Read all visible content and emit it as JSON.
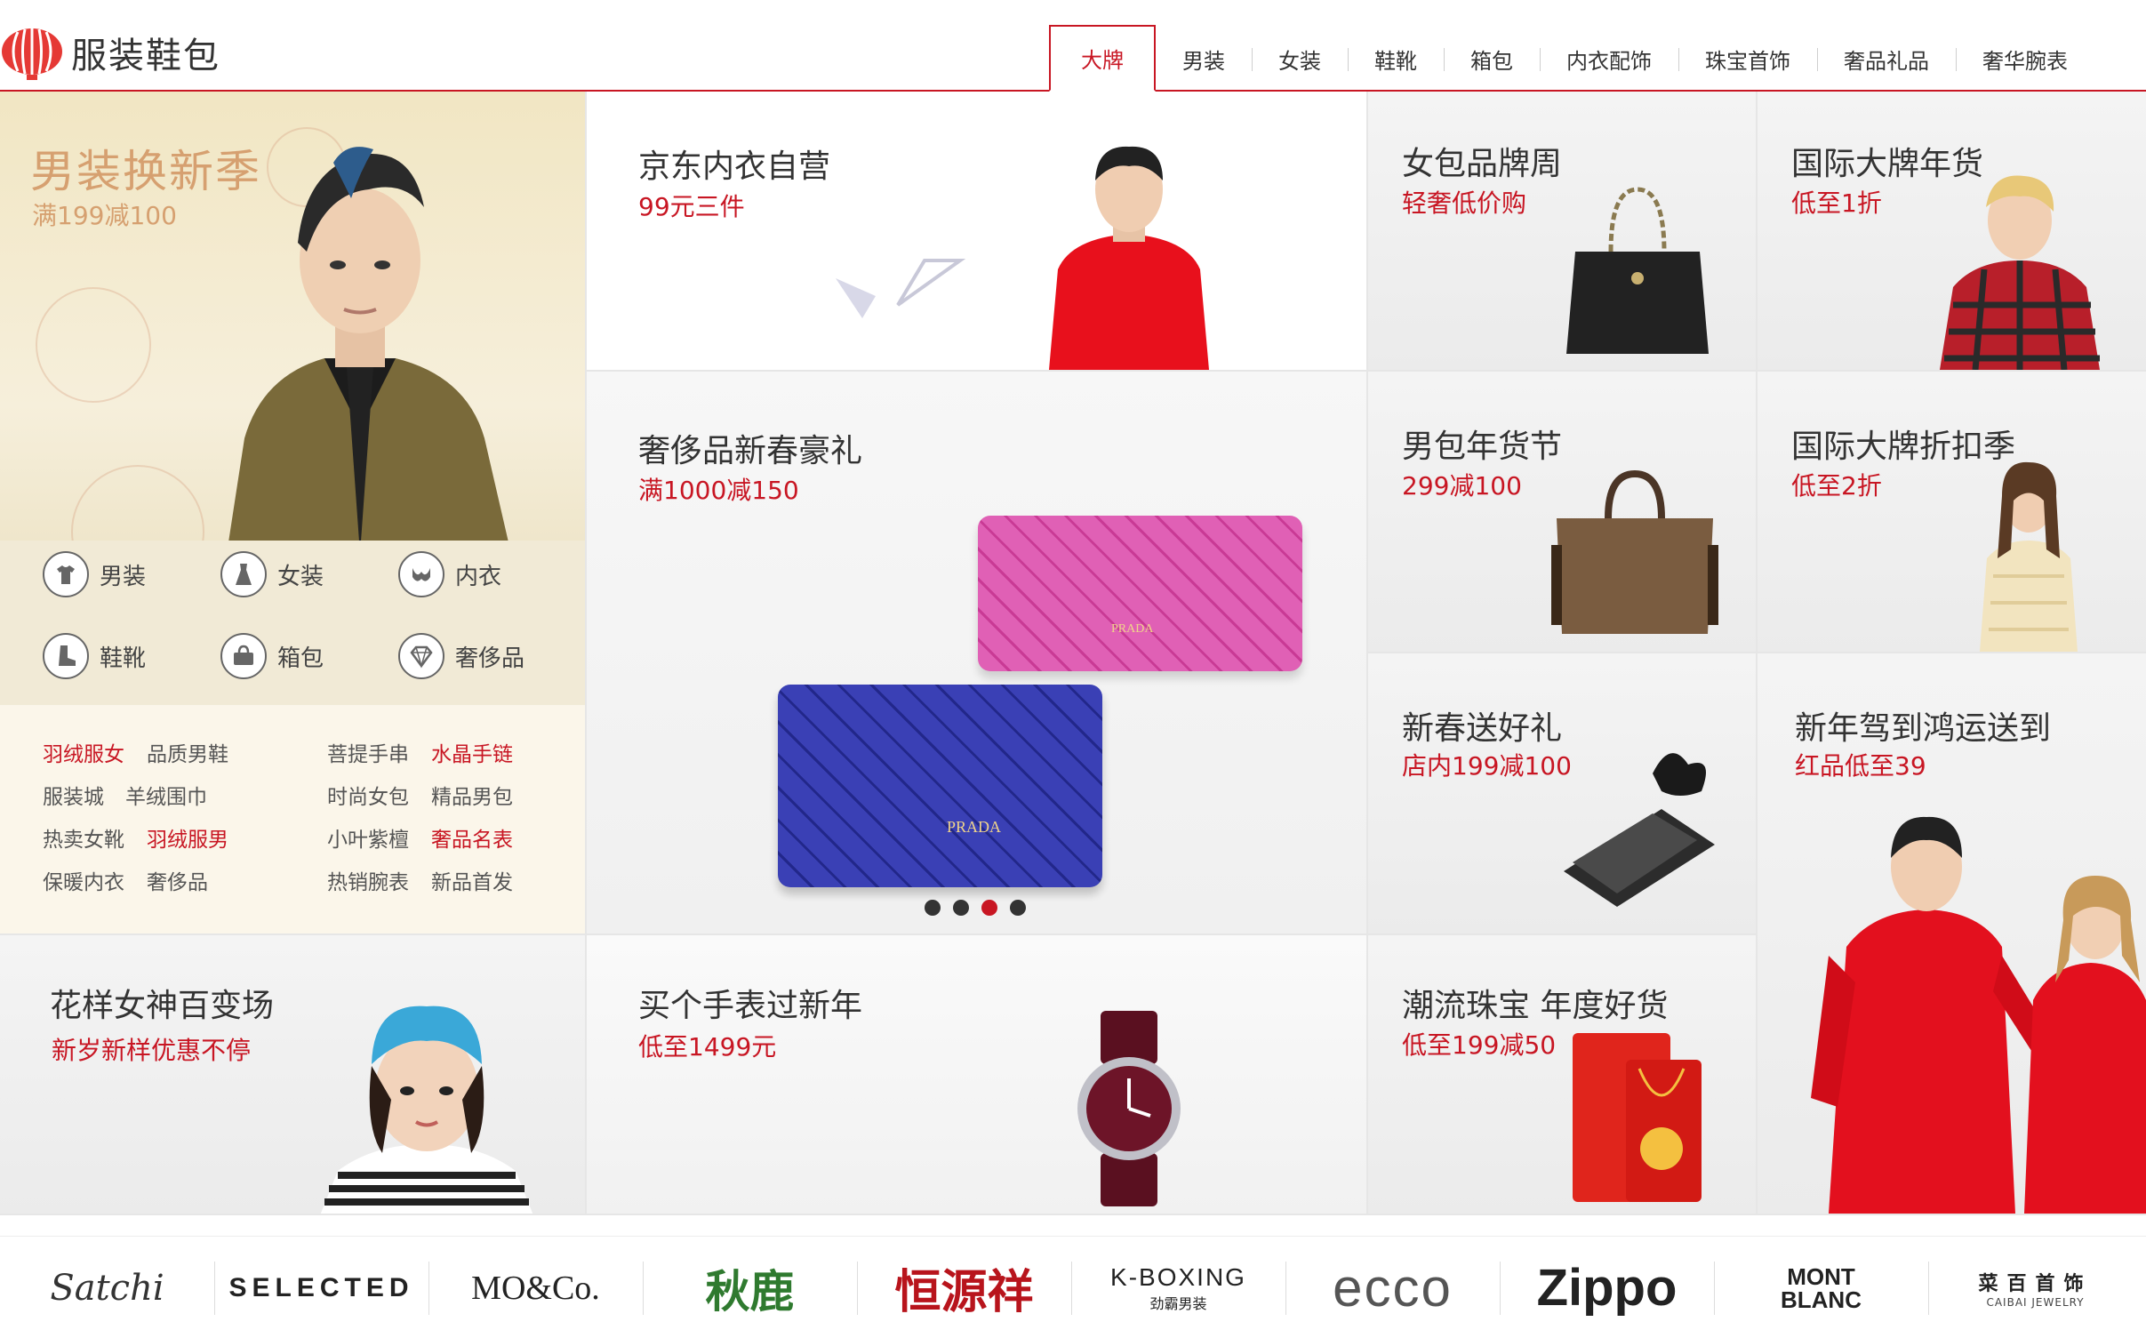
{
  "header": {
    "title": "服装鞋包",
    "tabs": [
      "大牌",
      "男装",
      "女装",
      "鞋靴",
      "箱包",
      "内衣配饰",
      "珠宝首饰",
      "奢品礼品",
      "奢华腕表"
    ],
    "active_tab": 0
  },
  "left": {
    "hero_title": "男装换新季",
    "hero_sub": "满199减100",
    "categories": [
      {
        "label": "男装",
        "icon": "tshirt-icon"
      },
      {
        "label": "女装",
        "icon": "dress-icon"
      },
      {
        "label": "内衣",
        "icon": "underwear-icon"
      },
      {
        "label": "鞋靴",
        "icon": "boot-icon"
      },
      {
        "label": "箱包",
        "icon": "bag-icon"
      },
      {
        "label": "奢侈品",
        "icon": "diamond-icon"
      }
    ],
    "links": [
      {
        "label": "羽绒服女",
        "red": true
      },
      {
        "label": "品质男鞋",
        "red": false
      },
      {
        "label": "菩提手串",
        "red": false
      },
      {
        "label": "水晶手链",
        "red": true
      },
      {
        "label": "服装城",
        "red": false
      },
      {
        "label": "羊绒围巾",
        "red": false
      },
      {
        "label": "时尚女包",
        "red": false
      },
      {
        "label": "精品男包",
        "red": false
      },
      {
        "label": "热卖女靴",
        "red": false
      },
      {
        "label": "羽绒服男",
        "red": true
      },
      {
        "label": "小叶紫檀",
        "red": false
      },
      {
        "label": "奢品名表",
        "red": true
      },
      {
        "label": "保暖内衣",
        "red": false
      },
      {
        "label": "奢侈品",
        "red": false
      },
      {
        "label": "热销腕表",
        "red": false
      },
      {
        "label": "新品首发",
        "red": false
      }
    ],
    "bottom_title": "花样女神百变场",
    "bottom_sub": "新岁新样优惠不停"
  },
  "tiles": {
    "jd_underwear": {
      "title": "京东内衣自营",
      "sub": "99元三件"
    },
    "luxury": {
      "title": "奢侈品新春豪礼",
      "sub": "满1000减150",
      "brand_text": "PRADA"
    },
    "watch": {
      "title": "买个手表过新年",
      "sub": "低至1499元"
    },
    "women_bag": {
      "title": "女包品牌周",
      "sub": "轻奢低价购"
    },
    "intl_brand": {
      "title": "国际大牌年货",
      "sub": "低至1折"
    },
    "men_bag": {
      "title": "男包年货节",
      "sub": "299减100"
    },
    "intl_discount": {
      "title": "国际大牌折扣季",
      "sub": "低至2折"
    },
    "gift": {
      "title": "新春送好礼",
      "sub": "店内199减100"
    },
    "lucky": {
      "title": "新年驾到鸿运送到",
      "sub": "红品低至39"
    },
    "jewelry": {
      "title": "潮流珠宝 年度好货",
      "sub": "低至199减50"
    }
  },
  "carousel": {
    "count": 4,
    "active": 2
  },
  "brands": [
    "Satchi",
    "SELECTED",
    "MO&Co.",
    "秋鹿",
    "恒源祥",
    "K-BOXING",
    "ecco",
    "Zippo",
    "MONT BLANC",
    "菜百首饰"
  ],
  "brand_extra": {
    "kboxing_sub": "劲霸男装",
    "caibai_en": "CAIBAI JEWELRY"
  },
  "colors": {
    "accent": "#c81623",
    "gold": "#d6a070"
  }
}
